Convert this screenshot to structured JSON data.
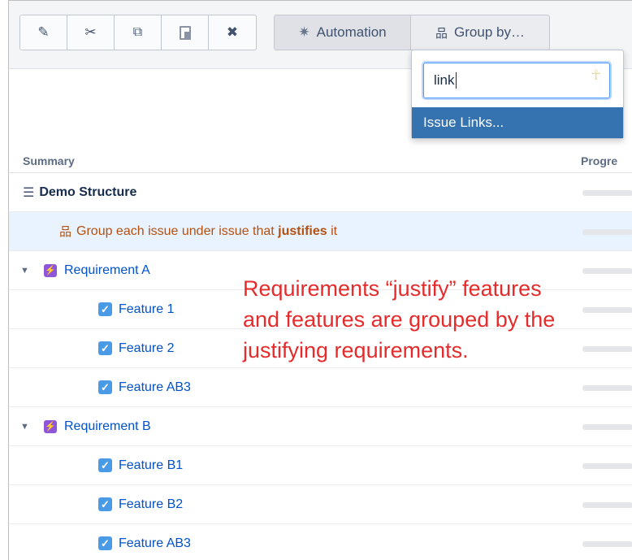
{
  "toolbar": {
    "edit_icon": "✎",
    "cut_icon": "✂",
    "copy_icon": "⧉",
    "paste_icon": "📋",
    "delete_icon": "✖",
    "automation_icon": "✷",
    "automation_label": "Automation",
    "groupby_icon": "品",
    "groupby_label": "Group by…"
  },
  "groupby_popup": {
    "search_value": "link",
    "option": "Issue Links..."
  },
  "columns": {
    "summary": "Summary",
    "progress": "Progre"
  },
  "rows": [
    {
      "label": "Demo Structure"
    },
    {
      "label_pre": "Group each issue under issue that ",
      "label_bold": "justifies",
      "label_post": " it"
    },
    {
      "label": "Requirement A"
    },
    {
      "label": "Feature 1"
    },
    {
      "label": "Feature 2"
    },
    {
      "label": "Feature AB3"
    },
    {
      "label": "Requirement B"
    },
    {
      "label": "Feature B1"
    },
    {
      "label": "Feature B2"
    },
    {
      "label": "Feature AB3"
    }
  ],
  "annotation": {
    "line1": "Requirements “justify” features",
    "line2": "and features are grouped by the",
    "line3": "justifying requirements."
  },
  "colors": {
    "annotation": "#e52b2b",
    "highlight_row": "#e9f2ff",
    "selected_option": "#3572b0",
    "requirement_icon": "#8f56d9",
    "feature_icon": "#4a9be6"
  }
}
